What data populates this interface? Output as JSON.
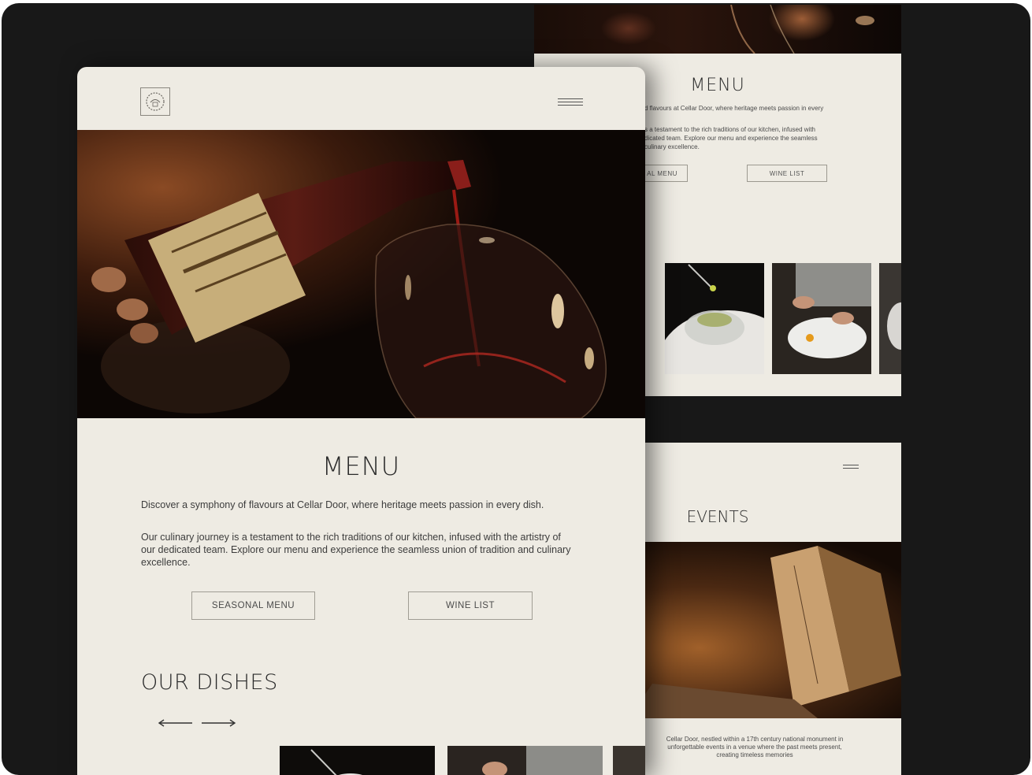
{
  "menu_preview": {
    "title": "MENU",
    "intro_line": "d flavours at Cellar Door, where heritage meets passion in every",
    "body_lines": [
      "s a testament to the rich traditions of our kitchen, infused with",
      "dicated team. Explore our menu and experience the seamless",
      "culinary excellence."
    ],
    "seasonal_button": "AL MENU",
    "wine_button": "WINE LIST"
  },
  "events_page": {
    "title": "EVENTS",
    "description_lines": [
      "Cellar Door, nestled within a 17th century national monument in",
      "unforgettable events in a venue where the past meets present,",
      "creating timeless memories"
    ]
  },
  "main_page": {
    "logo": "logo-icon",
    "menu_title": "MENU",
    "intro": "Discover a symphony of flavours at Cellar Door, where heritage meets passion in every dish.",
    "body": "Our culinary journey is a testament to the rich traditions of our kitchen, infused with the artistry of our dedicated team. Explore our menu and experience the seamless union of tradition and culinary excellence.",
    "seasonal_button": "SEASONAL MENU",
    "wine_button": "WINE LIST",
    "dishes_title": "OUR DISHES"
  },
  "colors": {
    "background": "#181818",
    "page": "#eeebe3",
    "text": "#2a2a2a"
  }
}
